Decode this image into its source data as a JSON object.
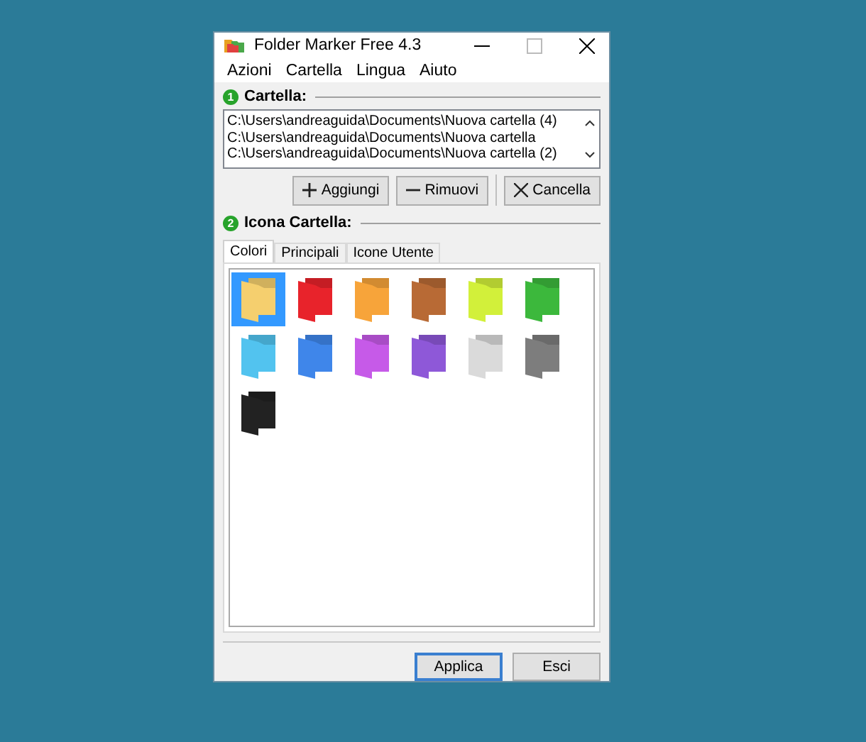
{
  "window": {
    "title": "Folder Marker Free 4.3"
  },
  "menu": [
    "Azioni",
    "Cartella",
    "Lingua",
    "Aiuto"
  ],
  "folders_section": {
    "number": "1",
    "title": "Cartella:",
    "paths": [
      "C:\\Users\\andreaguida\\Documents\\Nuova cartella (4)",
      "C:\\Users\\andreaguida\\Documents\\Nuova cartella",
      "C:\\Users\\andreaguida\\Documents\\Nuova cartella (2)"
    ]
  },
  "actions": [
    {
      "label": "Aggiungi",
      "kind": "add"
    },
    {
      "label": "Rimuovi",
      "kind": "remove"
    },
    {
      "label": "Cancella",
      "kind": "clear"
    }
  ],
  "icon_section": {
    "number": "2",
    "title": "Icona Cartella:"
  },
  "tabs": [
    {
      "label": "Colori",
      "selected": true
    },
    {
      "label": "Principali",
      "selected": false
    },
    {
      "label": "Icone Utente",
      "selected": false
    }
  ],
  "icons": [
    {
      "color": "#f5cf6e",
      "selected": true
    },
    {
      "color": "#e8232b",
      "selected": false
    },
    {
      "color": "#f7a43a",
      "selected": false
    },
    {
      "color": "#b86a35",
      "selected": false
    },
    {
      "color": "#d2f03a",
      "selected": false
    },
    {
      "color": "#3cb83c",
      "selected": false
    },
    {
      "color": "#52c3ef",
      "selected": false
    },
    {
      "color": "#3f86ea",
      "selected": false
    },
    {
      "color": "#c65ae8",
      "selected": false
    },
    {
      "color": "#8e58d8",
      "selected": false
    },
    {
      "color": "#dadada",
      "selected": false
    },
    {
      "color": "#7d7d7d",
      "selected": false
    },
    {
      "color": "#222222",
      "selected": false
    }
  ],
  "buttons": [
    {
      "label": "Applica",
      "default": true
    },
    {
      "label": "Esci",
      "default": false
    }
  ]
}
